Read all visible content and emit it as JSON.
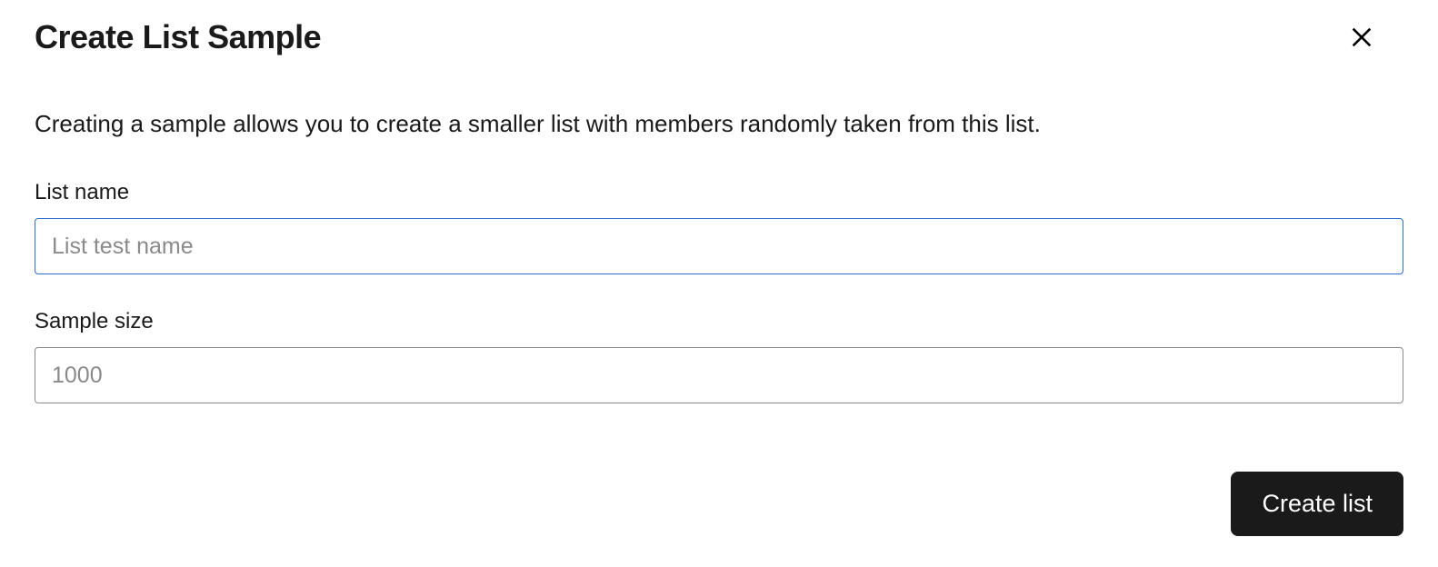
{
  "dialog": {
    "title": "Create List Sample",
    "description": "Creating a sample allows you to create a smaller list with members randomly taken from this list.",
    "fields": {
      "list_name": {
        "label": "List name",
        "placeholder": "List test name",
        "value": ""
      },
      "sample_size": {
        "label": "Sample size",
        "placeholder": "1000",
        "value": ""
      }
    },
    "actions": {
      "submit_label": "Create list"
    }
  }
}
